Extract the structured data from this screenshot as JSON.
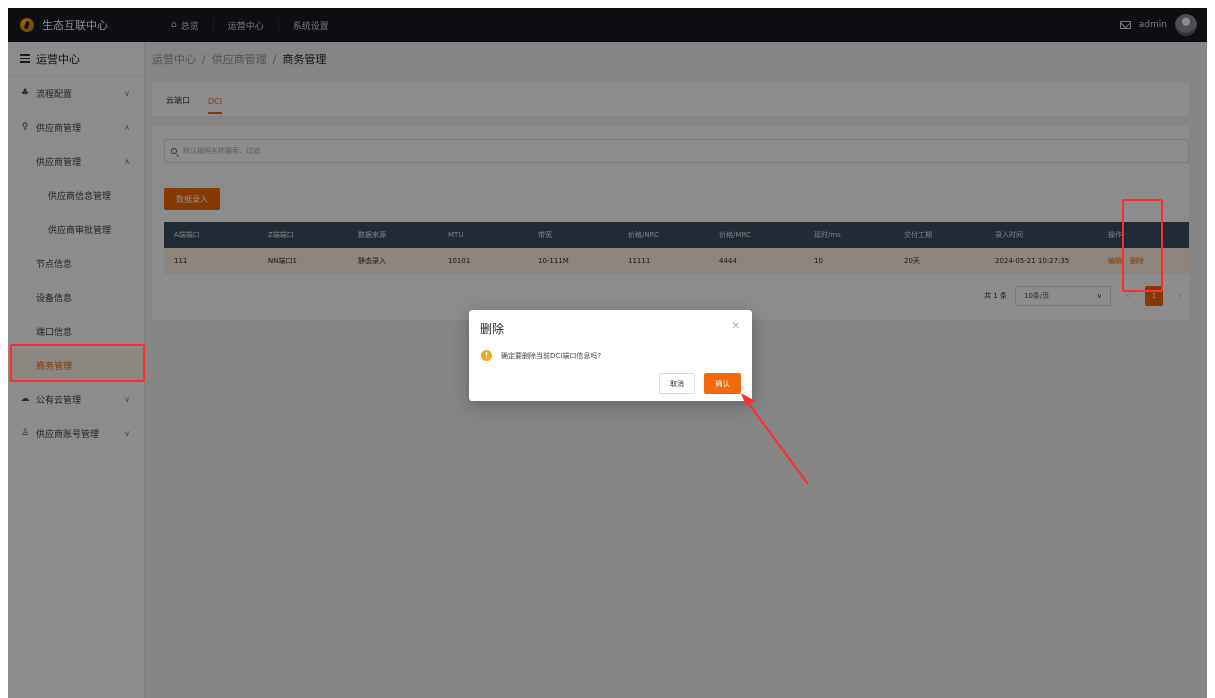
{
  "app": {
    "title": "生态互联中心"
  },
  "topnav": [
    {
      "label": "总览",
      "icon": "home-icon"
    },
    {
      "label": "运营中心"
    },
    {
      "label": "系统设置"
    }
  ],
  "user": {
    "name": "admin"
  },
  "sidebar": {
    "header": "运营中心",
    "items": [
      {
        "label": "流程配置",
        "icon": "user-group-icon"
      },
      {
        "label": "供应商管理",
        "icon": "supplier-icon"
      },
      {
        "label": "供应商管理"
      },
      {
        "label": "供应商信息管理"
      },
      {
        "label": "供应商审批管理"
      },
      {
        "label": "节点信息"
      },
      {
        "label": "设备信息"
      },
      {
        "label": "端口信息"
      },
      {
        "label": "商务管理"
      },
      {
        "label": "公有云管理",
        "icon": "cloud-icon"
      },
      {
        "label": "供应商账号管理",
        "icon": "person-icon"
      }
    ]
  },
  "breadcrumb": {
    "l1": "运营中心",
    "l2": "供应商管理",
    "l3": "商务管理",
    "sep": "/"
  },
  "tabs": [
    {
      "label": "云端口"
    },
    {
      "label": "DCI"
    }
  ],
  "search": {
    "placeholder": "默认按照名称搜索、过滤"
  },
  "toolbar": {
    "add_label": "数据录入"
  },
  "table": {
    "headers": [
      "A端端口",
      "Z端端口",
      "数据来源",
      "MTU",
      "带宽",
      "价格/NRC",
      "价格/MRC",
      "延时/ms",
      "交付工期",
      "录入时间",
      "操作"
    ],
    "rows": [
      {
        "a_port": "111",
        "z_port": "NN端口1",
        "source": "静态录入",
        "mtu": "10101",
        "bandwidth": "10-111M",
        "nrc": "11111",
        "mrc": "4444",
        "latency": "10",
        "delivery": "20天",
        "time": "2024-05-21 10:27:35",
        "edit": "编辑",
        "delete": "删除"
      }
    ]
  },
  "pagination": {
    "total": "共 1 条",
    "page_size": "10条/页",
    "current": "1"
  },
  "modal": {
    "title": "删除",
    "message": "确定要删除当前DCI端口信息吗?",
    "cancel_label": "取消",
    "confirm_label": "确认"
  },
  "colors": {
    "accent": "#f26b0a",
    "highlight": "#ff2d2d",
    "table_header": "#3d4f63",
    "topbar": "#1a1d24"
  }
}
